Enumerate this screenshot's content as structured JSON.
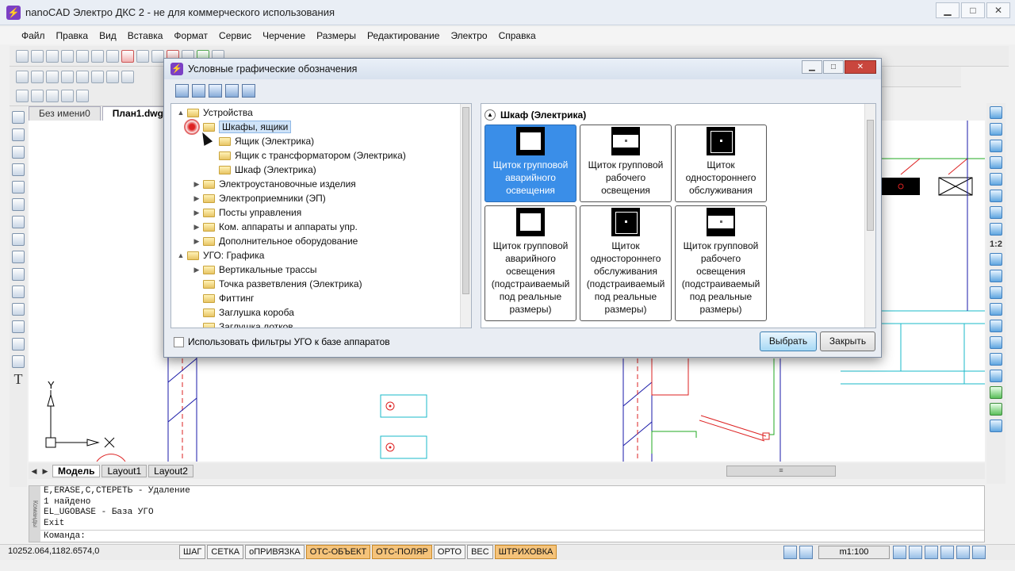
{
  "window": {
    "title": "nanoCAD Электро ДКС 2 - не для коммерческого использования"
  },
  "menu": [
    "Файл",
    "Правка",
    "Вид",
    "Вставка",
    "Формат",
    "Сервис",
    "Черчение",
    "Размеры",
    "Редактирование",
    "Электро",
    "Справка"
  ],
  "doc_tabs": [
    "Без имени0",
    "План1.dwg*"
  ],
  "layout_tabs": [
    "Модель",
    "Layout1",
    "Layout2"
  ],
  "dialog": {
    "title": "Условные графические обозначения",
    "tree": [
      {
        "label": "Устройства",
        "level": 0,
        "exp": "▲"
      },
      {
        "label": "Шкафы, ящики",
        "level": 1,
        "exp": "",
        "selected": true
      },
      {
        "label": "Ящик (Электрика)",
        "level": 2,
        "exp": ""
      },
      {
        "label": "Ящик с трансформатором (Электрика)",
        "level": 2,
        "exp": ""
      },
      {
        "label": "Шкаф (Электрика)",
        "level": 2,
        "exp": ""
      },
      {
        "label": "Электроустановочные изделия",
        "level": 1,
        "exp": "▶"
      },
      {
        "label": "Электроприемники (ЭП)",
        "level": 1,
        "exp": "▶"
      },
      {
        "label": "Посты управления",
        "level": 1,
        "exp": "▶"
      },
      {
        "label": "Ком. аппараты и аппараты упр.",
        "level": 1,
        "exp": "▶"
      },
      {
        "label": "Дополнительное оборудование",
        "level": 1,
        "exp": "▶"
      },
      {
        "label": "УГО: Графика",
        "level": 0,
        "exp": "▲"
      },
      {
        "label": "Вертикальные трассы",
        "level": 1,
        "exp": "▶"
      },
      {
        "label": "Точка разветвления (Электрика)",
        "level": 1,
        "exp": ""
      },
      {
        "label": "Фиттинг",
        "level": 1,
        "exp": ""
      },
      {
        "label": "Заглушка короба",
        "level": 1,
        "exp": ""
      },
      {
        "label": "Заглушка лотков",
        "level": 1,
        "exp": ""
      }
    ],
    "group_title": "Шкаф (Электрика)",
    "tiles": [
      {
        "lines": [
          "Щиток групповой",
          "аварийного",
          "освещения"
        ],
        "selected": true,
        "symbol": "cross"
      },
      {
        "lines": [
          "Щиток групповой",
          "рабочего",
          "освещения"
        ],
        "symbol": "white"
      },
      {
        "lines": [
          "Щиток",
          "одностороннего",
          "обслуживания"
        ],
        "symbol": "black"
      },
      {
        "lines": [
          "Щиток групповой",
          "аварийного",
          "освещения",
          "(подстраиваемый",
          "под реальные",
          "размеры)"
        ],
        "symbol": "cross"
      },
      {
        "lines": [
          "Щиток",
          "одностороннего",
          "обслуживания",
          "(подстраиваемый",
          "под реальные",
          "размеры)"
        ],
        "symbol": "black"
      },
      {
        "lines": [
          "Щиток групповой",
          "рабочего",
          "освещения",
          "(подстраиваемый",
          "под реальные",
          "размеры)"
        ],
        "symbol": "white"
      }
    ],
    "checkbox_label": "Использовать фильтры УГО к базе аппаратов",
    "select_button": "Выбрать",
    "close_button": "Закрыть"
  },
  "command_log": [
    "E,ERASE,C,СТЕРЕТЬ - Удаление",
    "1 найдено",
    "EL_UGOBASE - База УГО",
    "Exit"
  ],
  "command_prompt": "Команда:",
  "command_panel_label": "Команды",
  "status": {
    "coords": "10252.064,1182.6574,0",
    "toggles": [
      {
        "label": "ШАГ",
        "on": false
      },
      {
        "label": "СЕТКА",
        "on": false
      },
      {
        "label": "оПРИВЯЗКА",
        "on": false
      },
      {
        "label": "ОТС-ОБЪЕКТ",
        "on": true
      },
      {
        "label": "ОТС-ПОЛЯР",
        "on": true
      },
      {
        "label": "ОРТО",
        "on": false
      },
      {
        "label": "ВЕС",
        "on": false
      },
      {
        "label": "ШТРИХОВКА",
        "on": true
      }
    ],
    "scale": "m1:100"
  },
  "canvas": {
    "axis_x": "X",
    "axis_y": "Y"
  }
}
